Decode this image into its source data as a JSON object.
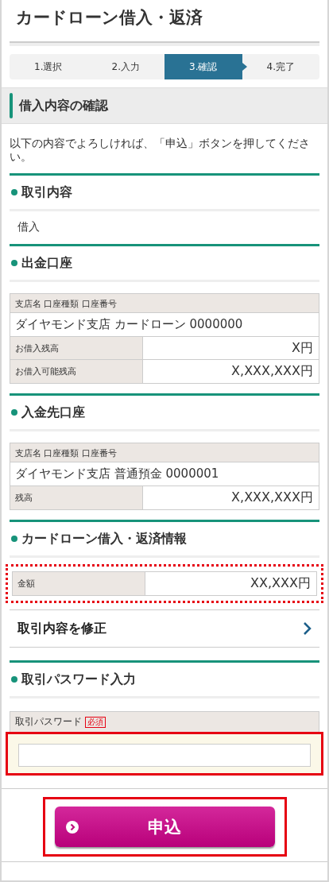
{
  "title": "カードローン借入・返済",
  "steps": [
    {
      "label": "1.選択",
      "selected": false
    },
    {
      "label": "2.入力",
      "selected": false
    },
    {
      "label": "3.確認",
      "selected": true
    },
    {
      "label": "4.完了",
      "selected": false
    }
  ],
  "page_heading": "借入内容の確認",
  "instruction": "以下の内容でよろしければ、「申込」ボタンを押してください。",
  "sections": [
    {
      "kind": "text",
      "heading": "取引内容",
      "value": "借入"
    },
    {
      "kind": "account",
      "heading": "出金口座",
      "header": "支店名 口座種類 口座番号",
      "account": "ダイヤモンド支店 カードローン 0000000",
      "rows": [
        {
          "label": "お借入残高",
          "value": "X円"
        },
        {
          "label": "お借入可能残高",
          "value": "X,XXX,XXX円"
        }
      ]
    },
    {
      "kind": "account",
      "heading": "入金先口座",
      "header": "支店名 口座種類 口座番号",
      "account": "ダイヤモンド支店 普通預金 0000001",
      "rows": [
        {
          "label": "残高",
          "value": "X,XXX,XXX円"
        }
      ]
    },
    {
      "kind": "amount",
      "heading": "カードローン借入・返済情報",
      "highlighted": true,
      "rows": [
        {
          "label": "金額",
          "value": "XX,XXX円"
        }
      ]
    }
  ],
  "edit_link": "取引内容を修正",
  "password": {
    "heading": "取引パスワード入力",
    "label": "取引パスワード",
    "badge": "必須",
    "highlighted": true
  },
  "submit": {
    "label": "申込",
    "highlighted": true
  }
}
